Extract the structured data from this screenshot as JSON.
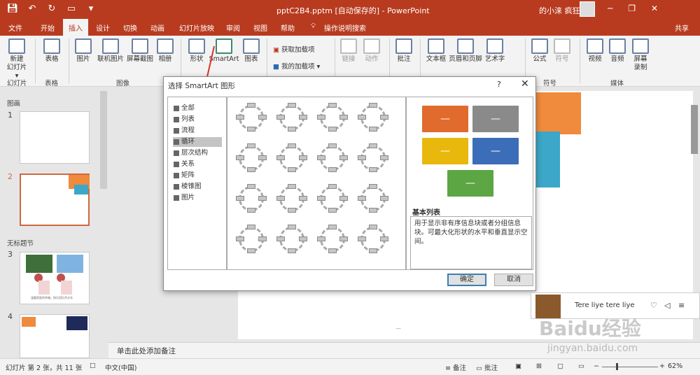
{
  "title_bar": {
    "file_title": "pptC2B4.pptm [自动保存的] - PowerPoint",
    "user": "的小涞 疯狂",
    "qat": [
      "save-icon",
      "undo-icon",
      "redo-icon",
      "present-icon",
      "more-icon"
    ],
    "win": [
      "─",
      "❐",
      "✕"
    ]
  },
  "tabs": [
    "文件",
    "开始",
    "插入",
    "设计",
    "切换",
    "动画",
    "幻灯片放映",
    "审阅",
    "视图",
    "帮助",
    "操作说明搜索"
  ],
  "share": "共享",
  "ribbon": {
    "new_slide": "新建\n幻灯片 ▾",
    "table": "表格",
    "picture": "图片",
    "online_picture": "联机图片",
    "screenshot": "屏幕截图",
    "album": "相册",
    "shapes": "形状",
    "smartart": "SmartArt",
    "chart": "图表",
    "get_addins": "获取加载项",
    "my_addins": "我的加载项",
    "link": "链接",
    "action": "动作",
    "comment": "批注",
    "textbox": "文本框",
    "header_footer": "页眉和页脚",
    "wordart": "艺术字",
    "equation": "公式",
    "symbol": "符号",
    "video": "视频",
    "audio": "音频",
    "screen_record": "屏幕\n录制",
    "groups": [
      "幻灯片",
      "表格",
      "图像",
      "符号",
      "媒体"
    ]
  },
  "thumbs": {
    "section1": "图画",
    "section2": "无标题节",
    "nums": [
      "1",
      "2",
      "3",
      "4"
    ],
    "caption3": "温暖家庭的幸福，快乐回忆共天年"
  },
  "dialog": {
    "title": "选择 SmartArt 图形",
    "help": "?",
    "close": "✕",
    "categories": [
      "全部",
      "列表",
      "流程",
      "循环",
      "层次结构",
      "关系",
      "矩阵",
      "棱锥图",
      "图片"
    ],
    "selected": 3,
    "preview_title": "基本列表",
    "preview_desc": "用于显示非有序信息块或者分组信息块。可最大化形状的水平和垂直显示空间。",
    "ok": "确定",
    "cancel": "取消",
    "colors": {
      "orange": "#e06b2c",
      "gray": "#8a8a8a",
      "yellow": "#e8b80d",
      "blue": "#3c6db8",
      "green": "#5ca644"
    }
  },
  "notes": "单击此处添加备注",
  "status": {
    "slide": "幻灯片 第 2 张，共 11 张",
    "lang": "中文(中国)",
    "notes": "备注",
    "comments": "批注",
    "zoom": "62%"
  },
  "music": {
    "track": "Tere liye tere liye"
  },
  "watermark": {
    "brand": "Baidu经验",
    "url": "jingyan.baidu.com"
  }
}
